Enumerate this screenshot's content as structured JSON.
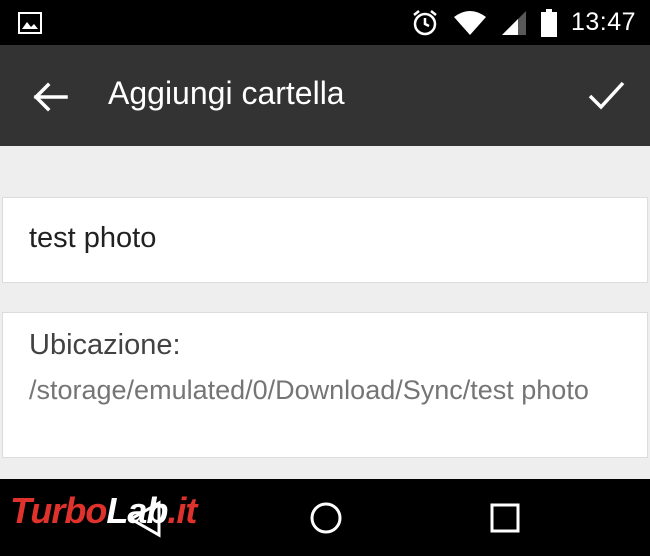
{
  "status_bar": {
    "time": "13:47",
    "icons": [
      "gallery-icon",
      "alarm-icon",
      "wifi-icon",
      "signal-icon",
      "battery-icon"
    ]
  },
  "toolbar": {
    "title": "Aggiungi cartella",
    "back_icon": "arrow-left-icon",
    "confirm_icon": "checkmark-icon"
  },
  "form": {
    "folder_label_value": "test photo",
    "location_label": "Ubicazione:",
    "location_path": "/storage/emulated/0/Download/Sync/test photo"
  },
  "nav_bar": {
    "icons": [
      "nav-back-icon",
      "nav-home-icon",
      "nav-recents-icon"
    ]
  },
  "watermark": {
    "part1": "Turbo",
    "part2": "Lab",
    "part3": ".it"
  },
  "colors": {
    "status_bar": "#000000",
    "toolbar": "#333333",
    "background": "#eeeeee",
    "card": "#ffffff",
    "watermark_red": "#e0322c"
  }
}
